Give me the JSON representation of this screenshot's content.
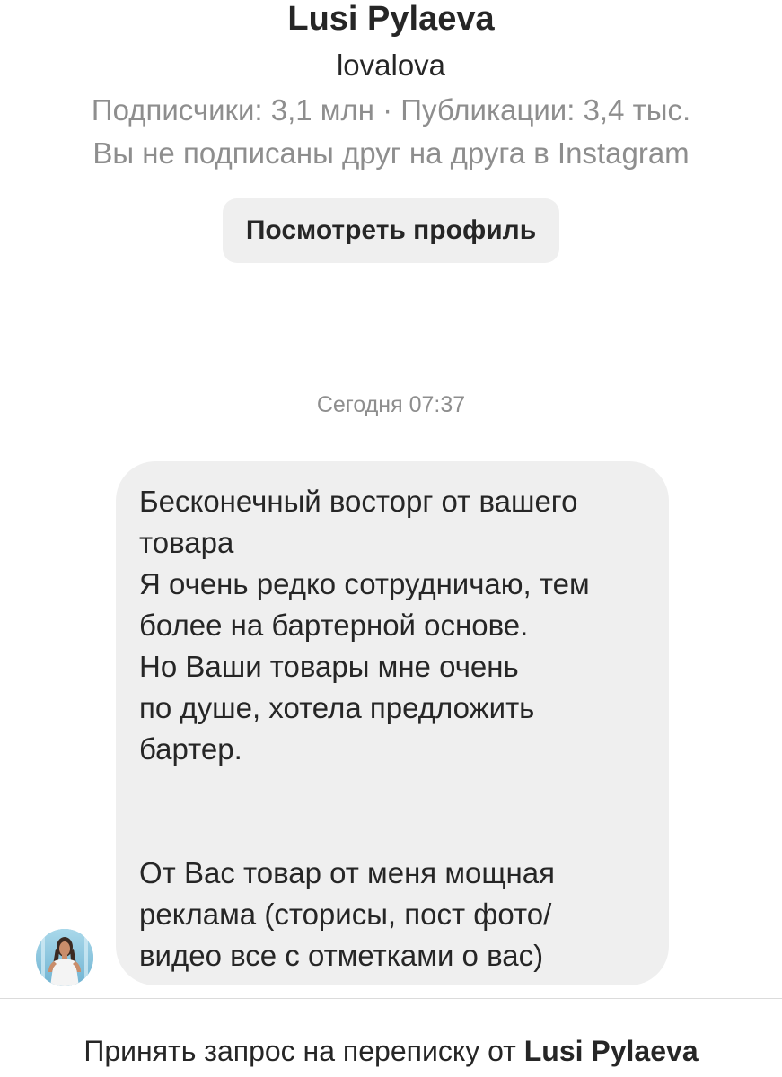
{
  "profile": {
    "name": "Lusi Pylaeva",
    "username": "lovalova",
    "stats": "Подписчики: 3,1 млн · Публикации: 3,4 тыс.",
    "follow_status": "Вы не подписаны друг на друга в Instagram",
    "view_profile_label": "Посмотреть профиль"
  },
  "thread": {
    "timestamp": "Сегодня 07:37",
    "message_lines": [
      "Бесконечный восторг от вашего",
      "товара",
      "Я очень редко сотрудничаю, тем",
      "более на бартерной основе.",
      "Но Ваши товары мне очень",
      "по душе, хотела предложить",
      "бартер.",
      "",
      "",
      "От Вас товар от меня мощная",
      "реклама (сторисы, пост фото/",
      "видео все с отметками о вас)"
    ],
    "sender_avatar_icon": "avatar-photo"
  },
  "footer": {
    "accept_prefix": "Принять запрос на переписку от",
    "accept_name": "Lusi Pylaeva"
  },
  "colors": {
    "text_primary": "#262626",
    "text_secondary": "#8e8e8e",
    "bubble_background": "#efefef",
    "button_background": "#efefef",
    "divider": "#dbdbdb"
  }
}
